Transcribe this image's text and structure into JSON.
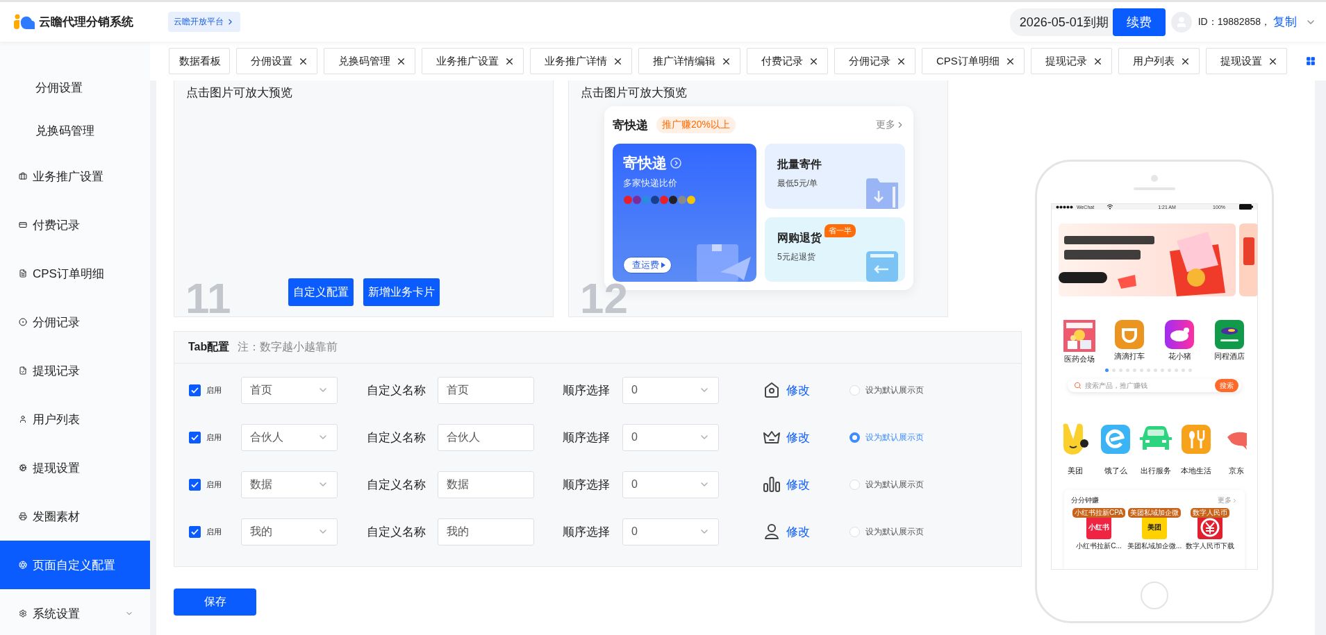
{
  "header": {
    "logo_text": "云瞻代理分销系统",
    "platform_link": "云瞻开放平台",
    "expiry": "2026-05-01到期",
    "renew_button": "续费",
    "user_id": "ID：19882858，",
    "copy_link": "复制"
  },
  "sidebar": {
    "items": [
      {
        "label": "分佣设置",
        "kind": "subitem",
        "selected": false
      },
      {
        "label": "兑换码管理",
        "kind": "subitem",
        "selected": false
      },
      {
        "label": "业务推广设置",
        "kind": "item",
        "selected": false
      },
      {
        "label": "付费记录",
        "kind": "item",
        "selected": false
      },
      {
        "label": "CPS订单明细",
        "kind": "item",
        "selected": false
      },
      {
        "label": "分佣记录",
        "kind": "item",
        "selected": false
      },
      {
        "label": "提现记录",
        "kind": "item",
        "selected": false
      },
      {
        "label": "用户列表",
        "kind": "item",
        "selected": false
      },
      {
        "label": "提现设置",
        "kind": "item",
        "selected": false
      },
      {
        "label": "发圈素材",
        "kind": "item",
        "selected": false
      },
      {
        "label": "页面自定义配置",
        "kind": "item",
        "selected": true
      },
      {
        "label": "系统设置",
        "kind": "group",
        "expanded": false,
        "selected": false
      }
    ]
  },
  "tabs": [
    {
      "label": "数据看板",
      "closable": false
    },
    {
      "label": "分佣设置",
      "closable": true
    },
    {
      "label": "兑换码管理",
      "closable": true
    },
    {
      "label": "业务推广设置",
      "closable": true
    },
    {
      "label": "业务推广详情",
      "closable": true
    },
    {
      "label": "推广详情编辑",
      "closable": true
    },
    {
      "label": "付费记录",
      "closable": true
    },
    {
      "label": "分佣记录",
      "closable": true
    },
    {
      "label": "CPS订单明细",
      "closable": true
    },
    {
      "label": "提现记录",
      "closable": true
    },
    {
      "label": "用户列表",
      "closable": true
    },
    {
      "label": "提现设置",
      "closable": true
    }
  ],
  "preview_cards": [
    {
      "kind": "buttons",
      "title": "点击图片可放大预览",
      "number": "11",
      "buttons": [
        "自定义配置",
        "新增业务卡片"
      ]
    },
    {
      "title": "点击图片可放大预览",
      "number": "12",
      "preview": {
        "title": "寄快递",
        "tag": "推广赚20%以上",
        "more": "更多",
        "main": {
          "title": "寄快递",
          "subtitle": "多家快递比价",
          "button": "查运费"
        },
        "tiles": [
          {
            "kind": "batch",
            "title": "批量寄件",
            "subtitle": "最低5元/单"
          },
          {
            "kind": "return",
            "title": "网购退货",
            "subtitle": "5元起退货",
            "badge": "省一半"
          }
        ]
      }
    }
  ],
  "tab_config": {
    "title": "Tab配置",
    "note": "注：数字越小越靠前",
    "rows": [
      {
        "enabled": true,
        "enable_label": "启用",
        "page": "首页",
        "name_label": "自定义名称",
        "custom_name": "首页",
        "order_label": "顺序选择",
        "order": "0",
        "kind": "home",
        "edit_link": "修改",
        "default_label": "设为默认展示页",
        "selected": false
      },
      {
        "enabled": true,
        "enable_label": "启用",
        "page": "合伙人",
        "name_label": "自定义名称",
        "custom_name": "合伙人",
        "order_label": "顺序选择",
        "order": "0",
        "kind": "crown",
        "edit_link": "修改",
        "default_label": "设为默认展示页",
        "selected": true
      },
      {
        "enabled": true,
        "enable_label": "启用",
        "page": "数据",
        "name_label": "自定义名称",
        "custom_name": "数据",
        "order_label": "顺序选择",
        "order": "0",
        "kind": "chart",
        "edit_link": "修改",
        "default_label": "设为默认展示页",
        "selected": false
      },
      {
        "enabled": true,
        "enable_label": "启用",
        "page": "我的",
        "name_label": "自定义名称",
        "custom_name": "我的",
        "order_label": "顺序选择",
        "order": "0",
        "kind": "user",
        "edit_link": "修改",
        "default_label": "设为默认展示页",
        "selected": false
      }
    ]
  },
  "save_button": "保存",
  "phone": {
    "status": {
      "carrier": "WeChat",
      "time": "1:21 AM",
      "battery": "100%"
    },
    "shortcuts": [
      {
        "label": "医药会场"
      },
      {
        "label": "滴滴打车",
        "kind": "didi"
      },
      {
        "label": "花小猪",
        "kind": "pig"
      },
      {
        "label": "同程酒店",
        "kind": "hotel"
      }
    ],
    "page_dots": [
      {
        "selected": true
      },
      {
        "selected": false
      },
      {
        "selected": false
      },
      {
        "selected": false
      },
      {
        "selected": false
      },
      {
        "selected": false
      },
      {
        "selected": false
      },
      {
        "selected": false
      },
      {
        "selected": false
      },
      {
        "selected": false
      },
      {
        "selected": false
      },
      {
        "selected": false
      },
      {
        "selected": false
      }
    ],
    "search": {
      "placeholder": "搜索产品，推广赚钱",
      "button": "搜索"
    },
    "services": [
      {
        "label": "美团",
        "kind": "rabbit"
      },
      {
        "label": "饿了么",
        "kind": "eleme"
      },
      {
        "label": "出行服务",
        "kind": "car"
      },
      {
        "label": "本地生活",
        "kind": "food"
      },
      {
        "label": "京东",
        "kind": "dog"
      }
    ],
    "earn_card": {
      "title": "分分钟赚",
      "more": "更多",
      "items": [
        {
          "kind": "red-logo",
          "badge": "小红书拉新CPA",
          "logo": "小红书",
          "name": "小红书拉新C..."
        },
        {
          "kind": "yellow-logo",
          "badge": "美团私域加企微",
          "logo": "美团",
          "name": "美团私域加企微..."
        },
        {
          "kind": "rmb",
          "badge": "数字人民币",
          "name": "数字人民币下载"
        }
      ]
    }
  }
}
